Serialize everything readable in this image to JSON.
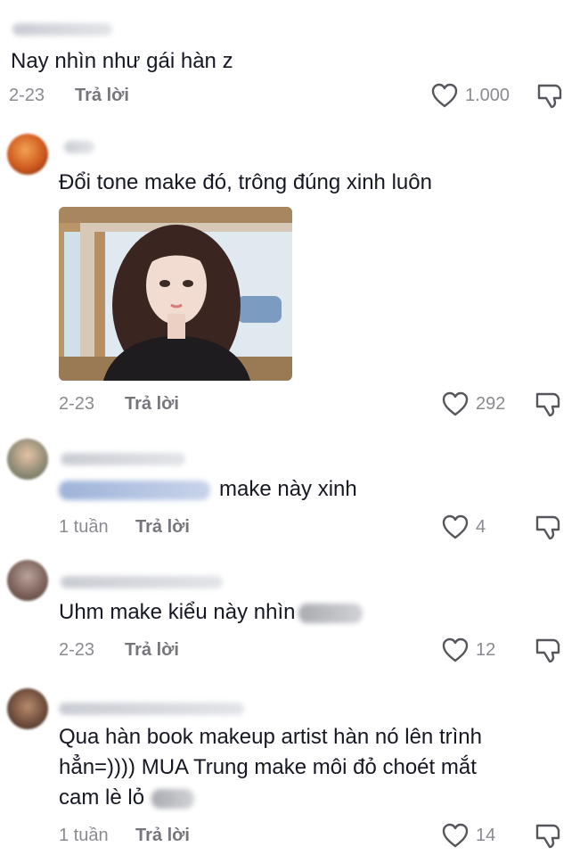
{
  "comments": [
    {
      "text": "Nay nhìn như gái hàn z",
      "date": "2-23",
      "reply_label": "Trả lời",
      "likes": "1.000"
    },
    {
      "text": "Đổi tone make đó, trông đúng xinh luôn",
      "date": "2-23",
      "reply_label": "Trả lời",
      "likes": "292"
    },
    {
      "text": "make này xinh",
      "date": "1 tuần",
      "reply_label": "Trả lời",
      "likes": "4"
    },
    {
      "text": "Uhm make kiểu này nhìn",
      "date": "2-23",
      "reply_label": "Trả lời",
      "likes": "12"
    },
    {
      "text_line1": "Qua hàn book makeup artist hàn nó lên trình",
      "text_line2": "hẳn=)))) MUA Trung make môi đỏ choét mắt",
      "text_line3": "cam lè lỏ",
      "date": "1 tuần",
      "reply_label": "Trả lời",
      "likes": "14"
    }
  ],
  "icons": {
    "like": "heart-outline-icon",
    "dislike": "thumbs-down-outline-icon"
  },
  "colors": {
    "text": "#161823",
    "meta": "#8a8b91",
    "icon": "#56575c"
  }
}
